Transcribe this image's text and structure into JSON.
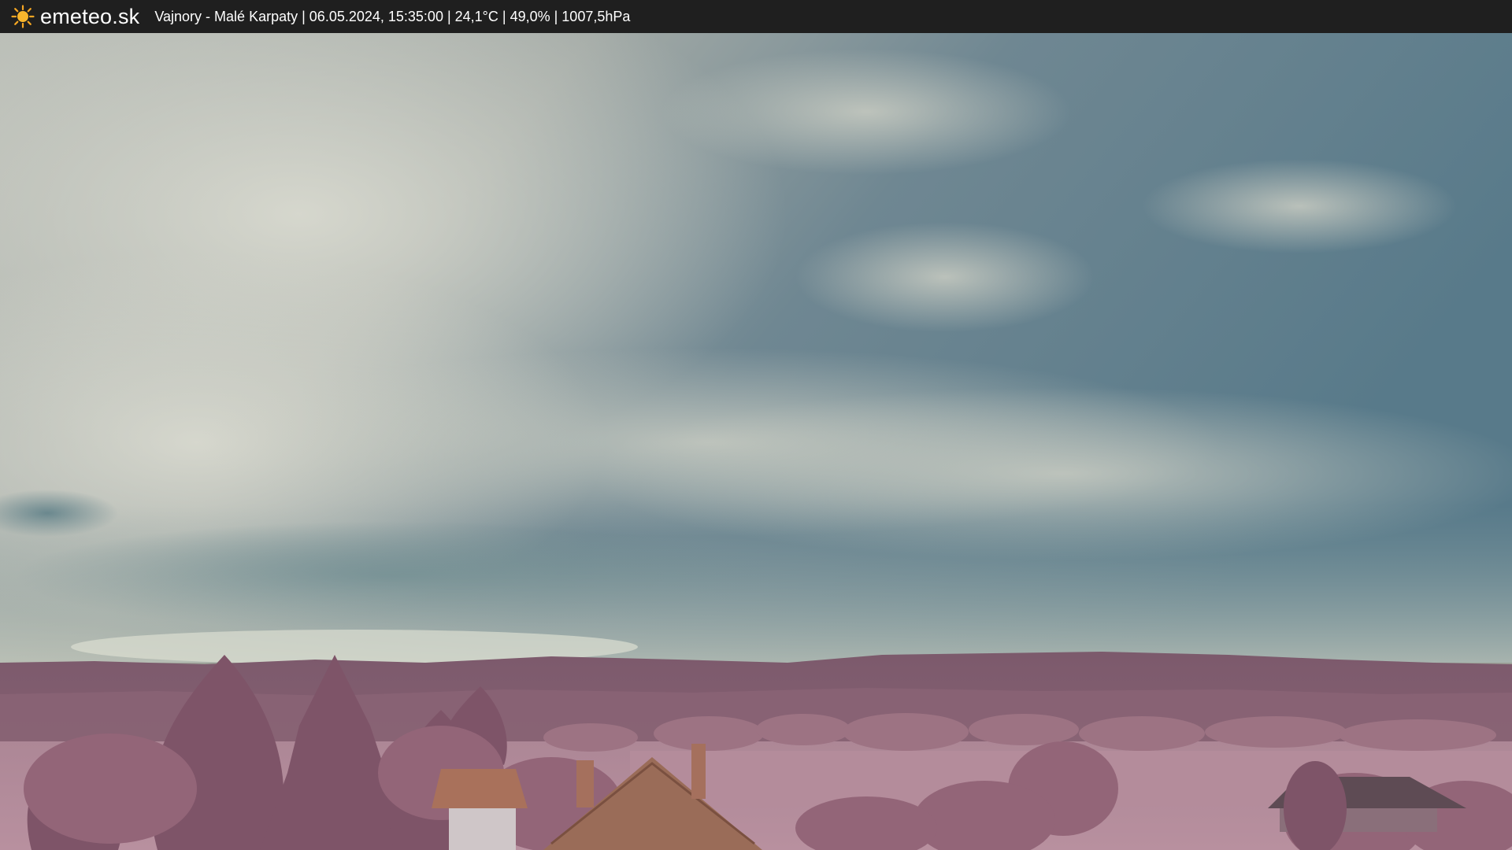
{
  "header": {
    "brand": "emeteo.sk",
    "logo_icon": "sun-icon",
    "location": "Vajnory - Malé Karpaty",
    "datetime": "06.05.2024, 15:35:00",
    "temperature": "24,1°C",
    "humidity": "49,0%",
    "pressure": "1007,5hPa",
    "separator": " | "
  },
  "colors": {
    "bar_background": "#1f1f1f",
    "bar_text": "#ffffff",
    "sun_accent": "#f5a623"
  }
}
